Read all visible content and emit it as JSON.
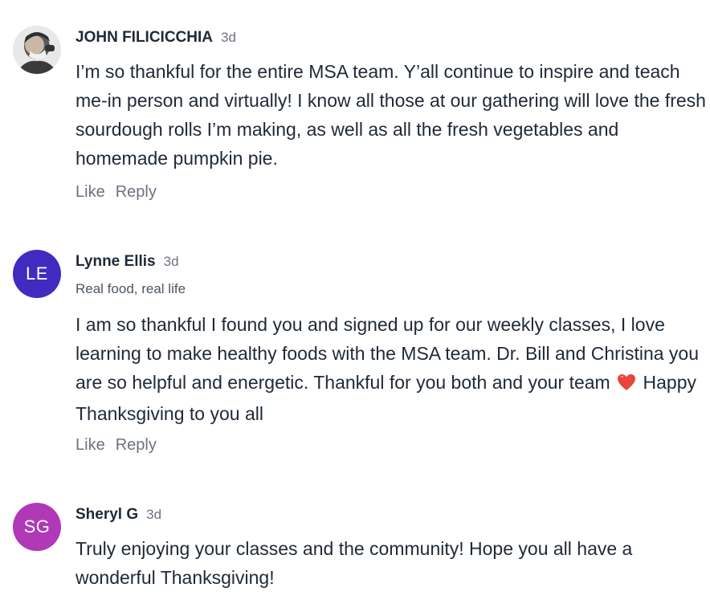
{
  "comments": [
    {
      "author": "JOHN FILICICCHIA",
      "time": "3d",
      "subtitle": "",
      "body": "I’m so thankful for the entire MSA team. Y’all continue to inspire and teach me-in person and virtually! I know all those at our gathering will love the fresh sourdough rolls I’m making, as well as all the fresh vegetables and homemade pumpkin pie.",
      "like_label": "Like",
      "reply_label": "Reply",
      "avatar_initials": ""
    },
    {
      "author": "Lynne Ellis",
      "time": "3d",
      "subtitle": "Real food, real life",
      "body_before_emoji": "I am so thankful I found you and signed up for our weekly classes, I love learning to make healthy foods with the MSA team. Dr. Bill and Christina you are so helpful and energetic. Thankful for you both and your team",
      "emoji": "red-heart-icon",
      "body_after_emoji": "Happy Thanksgiving to you all",
      "like_label": "Like",
      "reply_label": "Reply",
      "avatar_initials": "LE",
      "avatar_color": "#3f2bc0"
    },
    {
      "author": "Sheryl G",
      "time": "3d",
      "subtitle": "",
      "body": "Truly enjoying your classes and the community! Hope you all have a wonderful Thanksgiving!",
      "avatar_initials": "SG",
      "avatar_color": "#b039b7"
    }
  ]
}
